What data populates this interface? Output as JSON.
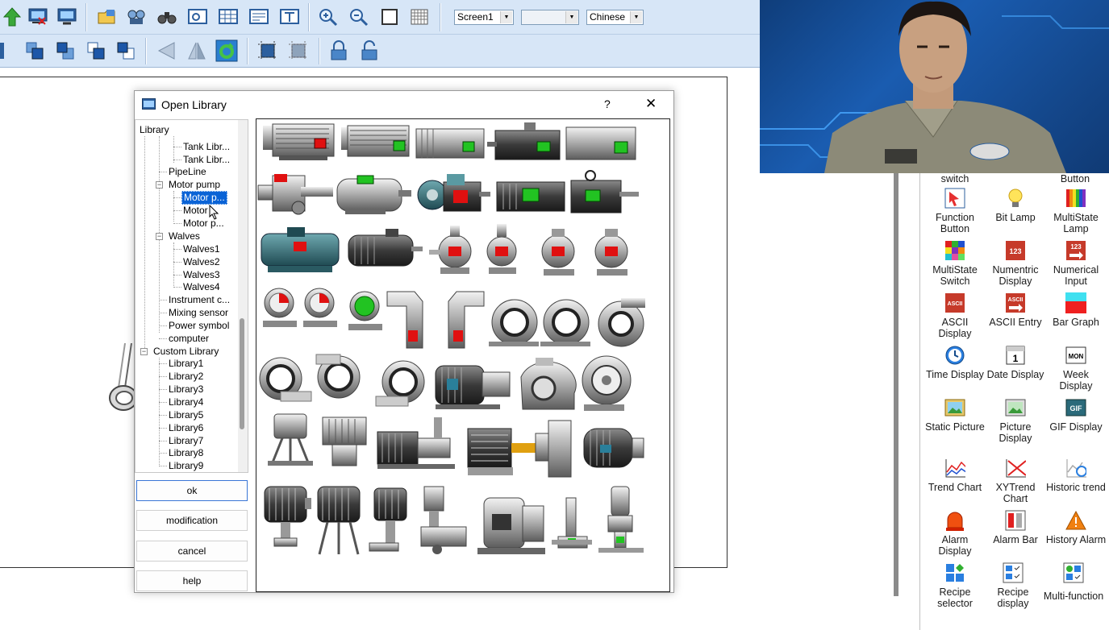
{
  "toolbar": {
    "screen_select": "Screen1",
    "blank_select": "",
    "language_select": "Chinese"
  },
  "dialog": {
    "title": "Open Library",
    "help_glyph": "?",
    "close_glyph": "✕",
    "tree": [
      {
        "label": "Library"
      },
      {
        "label": "Tank Libr..."
      },
      {
        "label": "Tank Libr..."
      },
      {
        "label": "PipeLine"
      },
      {
        "label": "Motor pump"
      },
      {
        "label": "Motor p..."
      },
      {
        "label": "Motor ..."
      },
      {
        "label": "Motor p..."
      },
      {
        "label": "Walves"
      },
      {
        "label": "Walves1"
      },
      {
        "label": "Walves2"
      },
      {
        "label": "Walves3"
      },
      {
        "label": "Walves4"
      },
      {
        "label": "Instrument c..."
      },
      {
        "label": "Mixing sensor"
      },
      {
        "label": "Power symbol"
      },
      {
        "label": "computer"
      },
      {
        "label": "Custom Library"
      },
      {
        "label": "Library1"
      },
      {
        "label": "Library2"
      },
      {
        "label": "Library3"
      },
      {
        "label": "Library4"
      },
      {
        "label": "Library5"
      },
      {
        "label": "Library6"
      },
      {
        "label": "Library7"
      },
      {
        "label": "Library8"
      },
      {
        "label": "Library9"
      }
    ],
    "buttons": {
      "ok": "ok",
      "modification": "modification",
      "cancel": "cancel",
      "help": "help"
    }
  },
  "panel": {
    "top_partial": [
      "switch",
      "Button"
    ],
    "objects": [
      {
        "label": "Function Button",
        "icon": "function-button-icon"
      },
      {
        "label": "Bit Lamp",
        "icon": "bit-lamp-icon"
      },
      {
        "label": "MultiState Lamp",
        "icon": "multistate-lamp-icon"
      },
      {
        "label": "MultiState Switch",
        "icon": "multistate-switch-icon"
      },
      {
        "label": "Numentric Display",
        "icon": "numeric-display-icon"
      },
      {
        "label": "Numerical Input",
        "icon": "numerical-input-icon"
      },
      {
        "label": "ASCII Display",
        "icon": "ascii-display-icon"
      },
      {
        "label": "ASCII Entry",
        "icon": "ascii-entry-icon"
      },
      {
        "label": "Bar Graph",
        "icon": "bar-graph-icon"
      },
      {
        "label": "Time Display",
        "icon": "clock-icon"
      },
      {
        "label": "Date Display",
        "icon": "calendar-icon"
      },
      {
        "label": "Week Display",
        "icon": "week-icon"
      },
      {
        "label": "Static Picture",
        "icon": "static-picture-icon"
      },
      {
        "label": "Picture Display",
        "icon": "picture-display-icon"
      },
      {
        "label": "GIF Display",
        "icon": "gif-icon"
      },
      {
        "label": "Trend Chart",
        "icon": "trend-chart-icon"
      },
      {
        "label": "XYTrend Chart",
        "icon": "xy-trend-icon"
      },
      {
        "label": "Historic trend",
        "icon": "historic-trend-icon"
      },
      {
        "label": "Alarm Display",
        "icon": "alarm-display-icon"
      },
      {
        "label": "Alarm Bar",
        "icon": "alarm-bar-icon"
      },
      {
        "label": "History Alarm",
        "icon": "history-alarm-icon"
      },
      {
        "label": "Recipe selector",
        "icon": "recipe-selector-icon"
      },
      {
        "label": "Recipe display",
        "icon": "recipe-display-icon"
      },
      {
        "label": "Multi-function",
        "icon": "multi-function-icon"
      }
    ],
    "icon_text": {
      "numeric": "123",
      "ascii": "ASCII",
      "date": "1",
      "week": "MON",
      "gif": "GIF"
    }
  },
  "colors": {
    "toolbar_bg": "#d7e6f7",
    "selection": "#0a63d6",
    "status_green": "#22c322",
    "status_red": "#e01010"
  }
}
